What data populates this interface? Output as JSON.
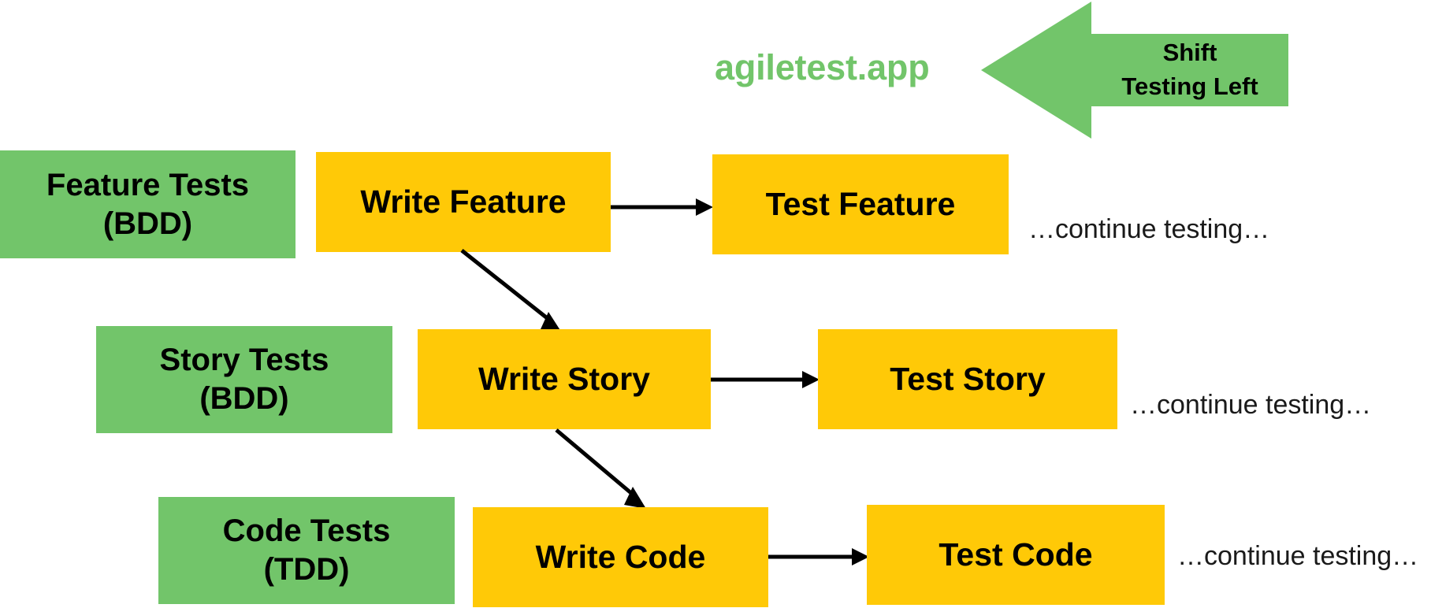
{
  "brand": {
    "text": "agiletest.app",
    "color": "#72C56A"
  },
  "callout_arrow": {
    "label": "Shift\nTesting Left",
    "direction": "left",
    "color": "#72C56A"
  },
  "colors": {
    "green": "#72C56A",
    "yellow": "#FFC907",
    "arrow_stroke": "#000000",
    "text": "#000000",
    "background": "#FFFFFF"
  },
  "rows": [
    {
      "category": "Feature Tests\n(BDD)",
      "write": "Write Feature",
      "test": "Test Feature",
      "continue": "…continue testing…"
    },
    {
      "category": "Story Tests\n(BDD)",
      "write": "Write Story",
      "test": "Test Story",
      "continue": "…continue testing…"
    },
    {
      "category": "Code Tests\n(TDD)",
      "write": "Write Code",
      "test": "Test Code",
      "continue": "…continue testing…"
    }
  ],
  "chart_data": {
    "type": "diagram",
    "title": "Shift Testing Left",
    "nodes": [
      {
        "id": "feature-tests",
        "label": "Feature Tests (BDD)",
        "kind": "category",
        "color": "#72C56A"
      },
      {
        "id": "write-feature",
        "label": "Write Feature",
        "kind": "action",
        "color": "#FFC907"
      },
      {
        "id": "test-feature",
        "label": "Test Feature",
        "kind": "action",
        "color": "#FFC907"
      },
      {
        "id": "story-tests",
        "label": "Story Tests (BDD)",
        "kind": "category",
        "color": "#72C56A"
      },
      {
        "id": "write-story",
        "label": "Write Story",
        "kind": "action",
        "color": "#FFC907"
      },
      {
        "id": "test-story",
        "label": "Test Story",
        "kind": "action",
        "color": "#FFC907"
      },
      {
        "id": "code-tests",
        "label": "Code Tests (TDD)",
        "kind": "category",
        "color": "#72C56A"
      },
      {
        "id": "write-code",
        "label": "Write Code",
        "kind": "action",
        "color": "#FFC907"
      },
      {
        "id": "test-code",
        "label": "Test Code",
        "kind": "action",
        "color": "#FFC907"
      }
    ],
    "edges": [
      {
        "from": "write-feature",
        "to": "test-feature",
        "style": "horizontal"
      },
      {
        "from": "write-feature",
        "to": "write-story",
        "style": "diagonal"
      },
      {
        "from": "write-story",
        "to": "test-story",
        "style": "horizontal"
      },
      {
        "from": "write-story",
        "to": "write-code",
        "style": "diagonal"
      },
      {
        "from": "write-code",
        "to": "test-code",
        "style": "horizontal"
      }
    ]
  }
}
